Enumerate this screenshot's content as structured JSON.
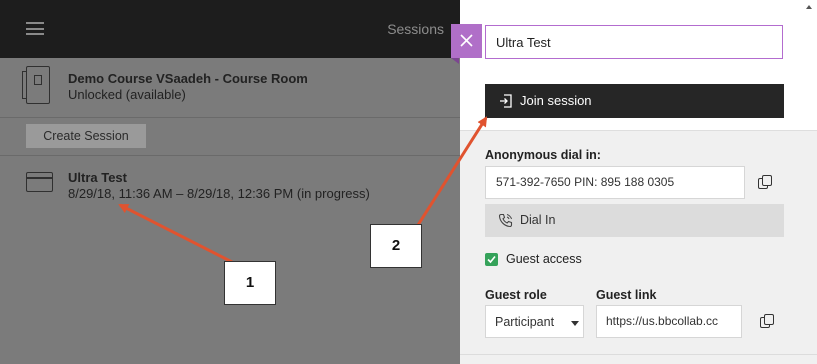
{
  "topbar": {
    "menu_icon": "hamburger-icon",
    "title": "Sessions"
  },
  "course_room": {
    "icon": "door-icon",
    "title": "Demo Course VSaadeh - Course Room",
    "status": "Unlocked (available)"
  },
  "create_session": {
    "label": "Create Session"
  },
  "session": {
    "icon": "calendar-icon",
    "title": "Ultra Test",
    "time": "8/29/18, 11:36 AM – 8/29/18, 12:36 PM (in progress)"
  },
  "drawer": {
    "close_icon": "close-icon",
    "session_name": "Ultra Test",
    "join": {
      "icon": "enter-icon",
      "label": "Join session"
    },
    "dial": {
      "heading": "Anonymous dial in:",
      "value": "571-392-7650 PIN: 895 188 0305",
      "copy_icon": "copy-icon",
      "button_icon": "phone-icon",
      "button_label": "Dial In"
    },
    "guest_access": {
      "label": "Guest access",
      "checked": true
    },
    "guest_role": {
      "heading": "Guest role",
      "value": "Participant"
    },
    "guest_link": {
      "heading": "Guest link",
      "value": "https://us.bbcollab.cc"
    }
  },
  "annotations": [
    {
      "label": "1",
      "points_to": "session"
    },
    {
      "label": "2",
      "points_to": "join-session-button"
    }
  ],
  "colors": {
    "accent_purple": "#b06fc8",
    "join_button": "#262626",
    "checkbox_green": "#35a25a",
    "arrow_red": "#e0532f",
    "overlay_gray": "#7b7b7b"
  }
}
